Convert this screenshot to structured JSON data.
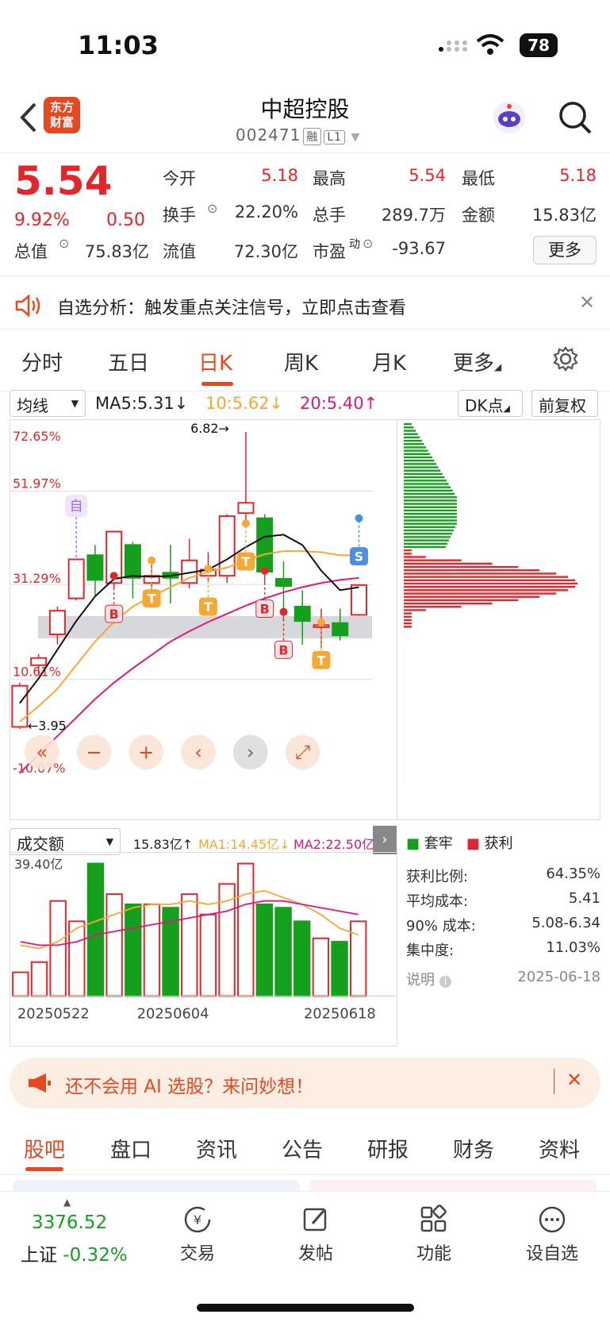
{
  "status": {
    "time": "11:03",
    "battery": "78"
  },
  "header": {
    "logo_line1": "东方",
    "logo_line2": "财富",
    "title": "中超控股",
    "code": "002471",
    "tag1": "融",
    "tag2": "L1"
  },
  "quote": {
    "price": "5.54",
    "pct": "9.92%",
    "change": "0.50",
    "fields": [
      {
        "label": "今开",
        "value": "5.18",
        "color": "red"
      },
      {
        "label": "最高",
        "value": "5.54",
        "color": "red"
      },
      {
        "label": "最低",
        "value": "5.18",
        "color": "red"
      },
      {
        "label": "换手",
        "value": "22.20%",
        "color": "normal"
      },
      {
        "label": "总手",
        "value": "289.7万",
        "color": "normal"
      },
      {
        "label": "金额",
        "value": "15.83亿",
        "color": "normal"
      },
      {
        "label": "总值",
        "value": "75.83亿",
        "color": "normal"
      },
      {
        "label": "流值",
        "value": "72.30亿",
        "color": "normal"
      },
      {
        "label": "市盈",
        "value": "-93.67",
        "color": "normal"
      }
    ],
    "pe_sup": "动",
    "more": "更多"
  },
  "alert": {
    "text": "自选分析：触发重点关注信号，立即点击查看"
  },
  "tabs": [
    "分时",
    "五日",
    "日K",
    "周K",
    "月K",
    "更多"
  ],
  "controls": {
    "ma_select": "均线",
    "ma5": "MA5:5.31↓",
    "ma10": "10:5.62↓",
    "ma20": "20:5.40↑",
    "dk": "DK点",
    "fq": "前复权"
  },
  "chart_data": {
    "type": "candlestick",
    "y_labels": [
      "72.65%",
      "51.97%",
      "31.29%",
      "10.61%",
      "-10.07%"
    ],
    "high_label": "6.82→",
    "low_label": "←3.95",
    "candles": [
      {
        "o": 3.95,
        "c": 4.35,
        "h": 4.38,
        "l": 3.93,
        "up": true
      },
      {
        "o": 4.55,
        "c": 4.62,
        "h": 4.66,
        "l": 4.45,
        "up": true
      },
      {
        "o": 4.85,
        "c": 5.08,
        "h": 5.12,
        "l": 4.75,
        "up": true
      },
      {
        "o": 5.2,
        "c": 5.58,
        "h": 5.58,
        "l": 5.18,
        "up": true
      },
      {
        "o": 5.62,
        "c": 5.38,
        "h": 5.72,
        "l": 5.22,
        "up": false
      },
      {
        "o": 5.35,
        "c": 5.85,
        "h": 5.85,
        "l": 5.3,
        "up": true
      },
      {
        "o": 5.72,
        "c": 5.4,
        "h": 5.75,
        "l": 5.2,
        "up": false
      },
      {
        "o": 5.35,
        "c": 5.42,
        "h": 5.6,
        "l": 5.15,
        "up": true
      },
      {
        "o": 5.45,
        "c": 5.4,
        "h": 5.72,
        "l": 5.15,
        "up": false
      },
      {
        "o": 5.35,
        "c": 5.57,
        "h": 5.78,
        "l": 5.3,
        "up": true
      },
      {
        "o": 5.42,
        "c": 5.48,
        "h": 5.65,
        "l": 5.35,
        "up": true
      },
      {
        "o": 5.42,
        "c": 6.0,
        "h": 6.02,
        "l": 5.35,
        "up": true
      },
      {
        "o": 6.03,
        "c": 6.13,
        "h": 6.82,
        "l": 5.95,
        "up": true
      },
      {
        "o": 5.98,
        "c": 5.46,
        "h": 6.02,
        "l": 5.35,
        "up": false
      },
      {
        "o": 5.39,
        "c": 5.32,
        "h": 5.56,
        "l": 5.0,
        "up": false
      },
      {
        "o": 5.12,
        "c": 4.98,
        "h": 5.28,
        "l": 4.75,
        "up": false
      },
      {
        "o": 4.94,
        "c": 4.92,
        "h": 5.1,
        "l": 4.72,
        "up": true
      },
      {
        "o": 4.96,
        "c": 4.84,
        "h": 5.1,
        "l": 4.79,
        "up": false
      },
      {
        "o": 5.04,
        "c": 5.33,
        "h": 5.34,
        "l": 5.03,
        "up": true
      }
    ],
    "ma5": [
      4.18,
      4.42,
      4.7,
      4.98,
      5.22,
      5.39,
      5.42,
      5.41,
      5.42,
      5.45,
      5.48,
      5.58,
      5.7,
      5.8,
      5.82,
      5.72,
      5.47,
      5.28,
      5.31
    ],
    "ma10": [
      4.0,
      4.15,
      4.32,
      4.55,
      4.78,
      4.97,
      5.12,
      5.22,
      5.31,
      5.4,
      5.46,
      5.5,
      5.57,
      5.63,
      5.66,
      5.66,
      5.65,
      5.62,
      5.62
    ],
    "ma20": [
      3.5,
      3.68,
      3.86,
      4.04,
      4.22,
      4.38,
      4.52,
      4.65,
      4.78,
      4.88,
      4.97,
      5.05,
      5.13,
      5.2,
      5.26,
      5.31,
      5.35,
      5.38,
      5.4
    ],
    "markers": [
      {
        "i": 5,
        "label": "B",
        "kind": "B",
        "level": 5.05
      },
      {
        "i": 7,
        "label": "T",
        "kind": "T",
        "level": 5.2
      },
      {
        "i": 10,
        "label": "T",
        "kind": "T",
        "level": 5.12
      },
      {
        "i": 12,
        "label": "T",
        "kind": "T",
        "level": 5.56
      },
      {
        "i": 13,
        "label": "B",
        "kind": "B",
        "level": 5.1
      },
      {
        "i": 14,
        "label": "B",
        "kind": "B",
        "level": 4.7
      },
      {
        "i": 16,
        "label": "T",
        "kind": "T",
        "level": 4.6
      },
      {
        "i": 18,
        "label": "S",
        "kind": "S",
        "level": 5.61
      },
      {
        "i": 3,
        "label": "自",
        "kind": "Z",
        "level": 6.1
      }
    ]
  },
  "volume": {
    "select": "成交额",
    "value": "15.83亿↑",
    "ma1": "MA1:14.45亿↓",
    "ma2": "MA2:22.50亿↑",
    "max_label": "39.40亿",
    "bars": [
      7,
      10,
      28,
      22,
      39,
      30,
      27,
      27,
      26,
      30,
      24,
      33,
      39,
      27,
      26,
      22,
      17,
      16,
      22
    ],
    "dates": [
      "20250522",
      "20250604",
      "20250618"
    ]
  },
  "legend": {
    "trap": "套牢",
    "profit": "获利"
  },
  "stats": [
    {
      "label": "获利比例:",
      "value": "64.35%"
    },
    {
      "label": "平均成本:",
      "value": "5.41"
    },
    {
      "label": "90% 成本:",
      "value": "5.08-6.34"
    },
    {
      "label": "集中度:",
      "value": "11.03%"
    },
    {
      "label": "说明",
      "value": "2025-06-18"
    }
  ],
  "banner": {
    "text": "还不会用 AI 选股？来问妙想！"
  },
  "bottom_tabs": [
    "股吧",
    "盘口",
    "资讯",
    "公告",
    "研报",
    "财务",
    "资料"
  ],
  "nav": {
    "index_value": "3376.52",
    "index_name": "上证",
    "index_change": "-0.32%",
    "items": [
      "交易",
      "发帖",
      "功能",
      "设自选"
    ]
  },
  "colors": {
    "up": "#e4262b",
    "down": "#14a01c",
    "accent": "#e8481f",
    "ma5": "#111111",
    "ma10": "#f7a834",
    "ma20": "#e0177f"
  }
}
